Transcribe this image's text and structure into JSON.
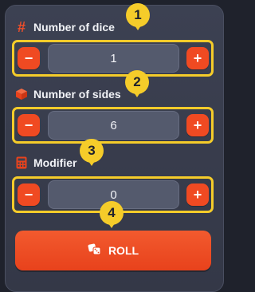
{
  "dice_count": {
    "label": "Number of dice",
    "icon": "hash-icon",
    "value": "1",
    "decrement": "−",
    "increment": "+"
  },
  "sides": {
    "label": "Number of sides",
    "icon": "cube-icon",
    "value": "6",
    "decrement": "−",
    "increment": "+"
  },
  "modifier": {
    "label": "Modifier",
    "icon": "calculator-icon",
    "value": "0",
    "decrement": "−",
    "increment": "+"
  },
  "roll_button": {
    "label": "ROLL",
    "icon": "dice-icon"
  },
  "markers": [
    "1",
    "2",
    "3",
    "4"
  ],
  "colors": {
    "accent": "#f04a22",
    "highlight": "#f5cc2a",
    "panel": "#3c4152"
  }
}
